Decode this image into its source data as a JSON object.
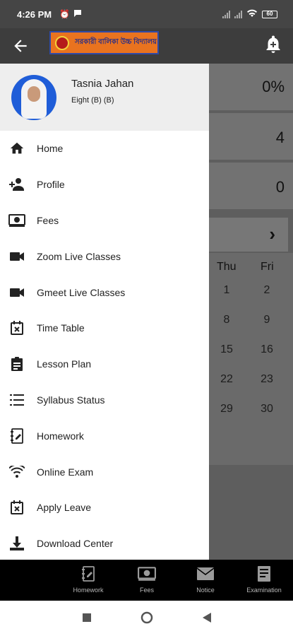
{
  "status_bar": {
    "time": "4:26 PM",
    "battery": "60"
  },
  "app_bar": {
    "logo_text": "সরকারী বালিকা উচ্চ বিদ্যালয়"
  },
  "dashboard": {
    "values": [
      "0%",
      "4",
      "0"
    ],
    "calendar": {
      "headers": [
        "Thu",
        "Fri"
      ],
      "rows": [
        [
          "1",
          "2"
        ],
        [
          "8",
          "9"
        ],
        [
          "15",
          "16"
        ],
        [
          "22",
          "23"
        ],
        [
          "29",
          "30"
        ]
      ]
    }
  },
  "drawer": {
    "profile": {
      "name": "Tasnia Jahan",
      "class": "Eight (B) (B)"
    },
    "items": [
      {
        "label": "Home",
        "icon": "home-icon"
      },
      {
        "label": "Profile",
        "icon": "person-add-icon"
      },
      {
        "label": "Fees",
        "icon": "money-icon"
      },
      {
        "label": "Zoom Live Classes",
        "icon": "video-camera-icon"
      },
      {
        "label": "Gmeet Live Classes",
        "icon": "video-camera-icon"
      },
      {
        "label": "Time Table",
        "icon": "calendar-x-icon"
      },
      {
        "label": "Lesson Plan",
        "icon": "clipboard-icon"
      },
      {
        "label": "Syllabus Status",
        "icon": "list-icon"
      },
      {
        "label": "Homework",
        "icon": "homework-icon"
      },
      {
        "label": "Online Exam",
        "icon": "wifi-icon"
      },
      {
        "label": "Apply Leave",
        "icon": "calendar-x-icon"
      },
      {
        "label": "Download Center",
        "icon": "download-icon"
      }
    ]
  },
  "tab_bar": {
    "tabs": [
      {
        "label": "Homework",
        "icon": "homework-icon"
      },
      {
        "label": "Fees",
        "icon": "money-icon"
      },
      {
        "label": "Notice",
        "icon": "envelope-icon"
      },
      {
        "label": "Examination",
        "icon": "exam-icon"
      }
    ]
  }
}
